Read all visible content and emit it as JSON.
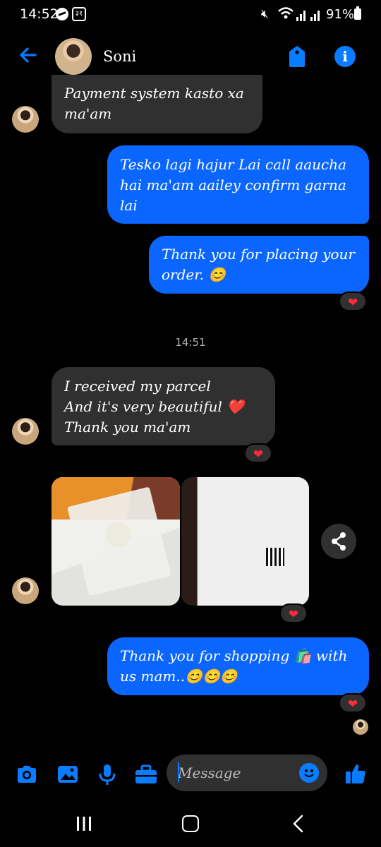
{
  "status_bar": {
    "time": "14:52",
    "calendar_badge": "३१",
    "battery": "91%",
    "icons": [
      "messenger-icon",
      "calendar-icon",
      "mute-icon",
      "wifi-icon",
      "signal-icon",
      "signal-icon",
      "battery-icon"
    ]
  },
  "header": {
    "contact_name": "Soni",
    "icons": [
      "back-arrow-icon",
      "tag-icon",
      "info-icon"
    ]
  },
  "messages": [
    {
      "direction": "incoming",
      "lines": [
        "Payment system kasto xa",
        "ma'am"
      ]
    },
    {
      "direction": "outgoing",
      "lines": [
        "Tesko lagi hajur Lai call aaucha",
        "hai ma'am aailey confirm garna",
        "lai"
      ]
    },
    {
      "direction": "outgoing",
      "lines": [
        "Thank you for placing your",
        "order. 😊"
      ],
      "reaction": "❤"
    },
    {
      "direction": "incoming",
      "lines": [
        "I received my parcel",
        "And it's very beautiful ❤️",
        "Thank you ma'am"
      ],
      "reaction": "❤"
    },
    {
      "direction": "incoming",
      "type": "photos",
      "photo_count": 2,
      "reaction": "❤"
    },
    {
      "direction": "outgoing",
      "lines": [
        "Thank you for shopping 🛍️ with",
        "us mam..😊😊😊"
      ],
      "reaction": "❤"
    }
  ],
  "timestamp": "14:51",
  "composer": {
    "placeholder": "Message",
    "icons": [
      "camera-icon",
      "gallery-icon",
      "microphone-icon",
      "toolbox-icon",
      "emoji-icon",
      "thumbs-up-icon"
    ]
  },
  "colors": {
    "accent": "#0a7cff",
    "outgoing_bubble": "#0a66ff",
    "incoming_bubble": "#303030",
    "background": "#000000",
    "reaction_heart": "#ff2a3a"
  }
}
